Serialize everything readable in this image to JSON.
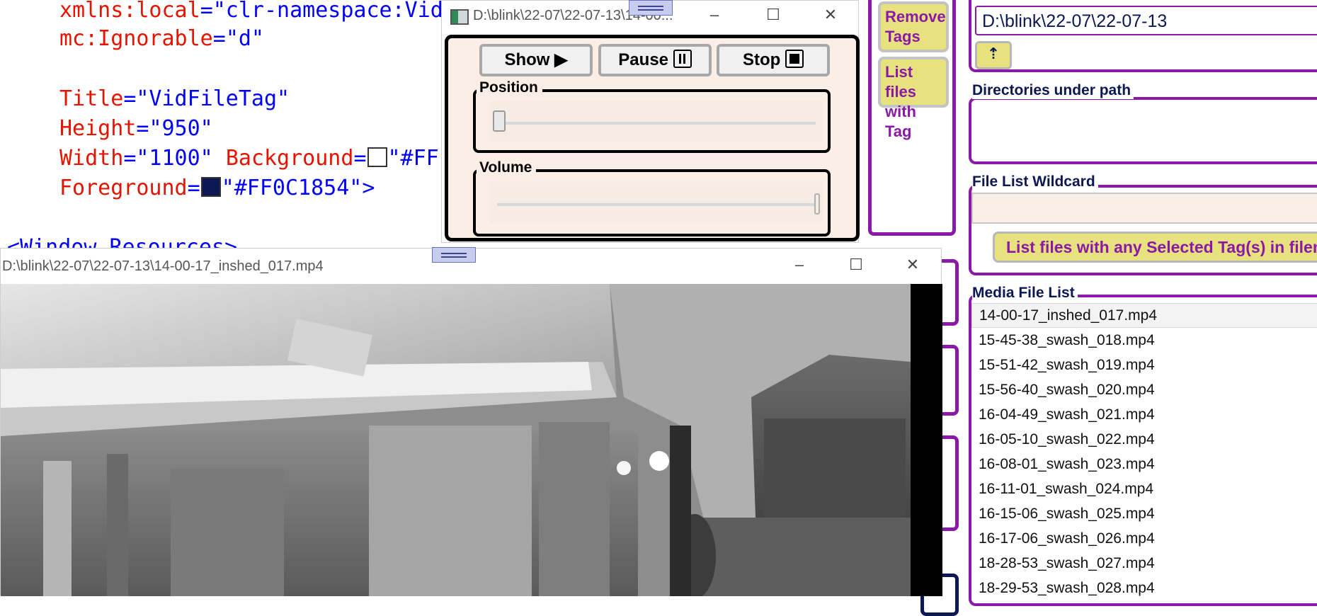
{
  "code_editor": {
    "lines": [
      {
        "attr": "xmlns:local",
        "op": "=",
        "value": "\"clr-namespace:Vid"
      },
      {
        "attr": "mc:Ignorable",
        "op": "=",
        "value": "\"d\""
      },
      {
        "attr": "Title",
        "op": "=",
        "value": "\"VidFileTag\""
      },
      {
        "attr": "Height",
        "op": "=",
        "value": "\"950\""
      },
      {
        "attr": "Width",
        "op": "=",
        "value": "\"1100\""
      },
      {
        "attr": "Background",
        "op": "=",
        "value": "\"#FF"
      },
      {
        "attr": "Foreground",
        "op": "=",
        "value": "\"#FF0C1854\">"
      },
      {
        "attr": "",
        "op": "",
        "value": "<Window.Resources>"
      }
    ],
    "background_swatch_color": "#ffffff",
    "foreground_swatch_color": "#0c1854"
  },
  "controller_window": {
    "title": "D:\\blink\\22-07\\22-07-13\\14-00...",
    "show_label": "Show ▶",
    "pause_label": "Pause",
    "stop_label": "Stop",
    "position_label": "Position",
    "volume_label": "Volume",
    "position_value": 0.0,
    "volume_value": 1.0
  },
  "video_window": {
    "title": "D:\\blink\\22-07\\22-07-13\\14-00-17_inshed_017.mp4"
  },
  "app": {
    "remove_tags_label": "Remove Tags",
    "list_files_with_tag_label": "List files with Tag",
    "path_value": "D:\\blink\\22-07\\22-07-13",
    "up_button_label": "⇡",
    "directories_label": "Directories under path",
    "wildcard_label": "File List Wildcard",
    "list_selected_button_label": "List files with any Selected Tag(s) in filena",
    "media_file_list_label": "Media File List",
    "media_files": [
      "14-00-17_inshed_017.mp4",
      "15-45-38_swash_018.mp4",
      "15-51-42_swash_019.mp4",
      "15-56-40_swash_020.mp4",
      "16-04-49_swash_021.mp4",
      "16-05-10_swash_022.mp4",
      "16-08-01_swash_023.mp4",
      "16-11-01_swash_024.mp4",
      "16-15-06_swash_025.mp4",
      "16-17-06_swash_026.mp4",
      "18-28-53_swash_027.mp4",
      "18-29-53_swash_028.mp4"
    ],
    "selected_index": 0
  },
  "colors": {
    "accent": "#8b19a8",
    "button_fill": "#e8e27e",
    "panel_fill": "#fbeee4",
    "text_dark": "#0c1854"
  }
}
